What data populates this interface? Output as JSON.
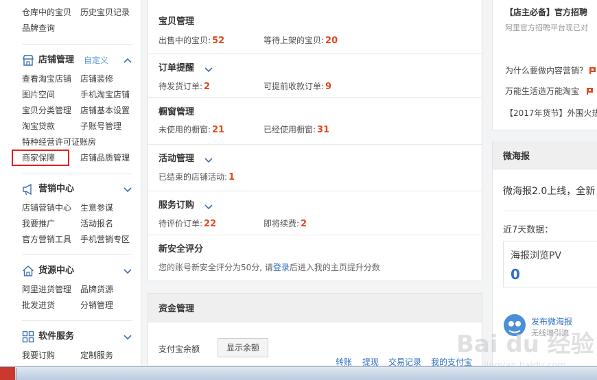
{
  "sidebar": {
    "top_row": {
      "a": "仓库中的宝贝",
      "b": "历史宝贝记录"
    },
    "brand_query": "品牌查询",
    "store": {
      "title": "店铺管理",
      "customize": "自定义",
      "links": [
        [
          "查看淘宝店铺",
          "店铺装修"
        ],
        [
          "图片空间",
          "手机淘宝店铺"
        ],
        [
          "宝贝分类管理",
          "店铺基本设置"
        ],
        [
          "淘宝贷款",
          "子账号管理"
        ],
        [
          "特种经营许可证账房",
          ""
        ],
        [
          "商家保障",
          "店铺品质管理"
        ]
      ]
    },
    "marketing": {
      "title": "营销中心",
      "links": [
        [
          "店铺营销中心",
          "生意参谋"
        ],
        [
          "我要推广",
          "活动报名"
        ],
        [
          "官方营销工具",
          "手机营销专区"
        ]
      ]
    },
    "sourcing": {
      "title": "货源中心",
      "links": [
        [
          "阿里进货管理",
          "品牌货源"
        ],
        [
          "批发进货",
          "分销管理"
        ]
      ]
    },
    "software": {
      "title": "软件服务",
      "links": [
        [
          "我要订购",
          "定制服务"
        ]
      ]
    }
  },
  "main": {
    "items": {
      "title": "宝贝管理",
      "on_sale_label": "出售中的宝贝:",
      "on_sale": "52",
      "pending_label": "等待上架的宝贝:",
      "pending": "20"
    },
    "orders": {
      "title": "订单提醒",
      "to_ship_label": "待发货订单:",
      "to_ship": "2",
      "early_pay_label": "可提前收款订单:",
      "early_pay": "9"
    },
    "window": {
      "title": "橱窗管理",
      "unused_label": "未使用的橱窗:",
      "unused": "21",
      "used_label": "已经使用橱窗:",
      "used": "31"
    },
    "activity": {
      "title": "活动管理",
      "ended_label": "已结束的店铺活动:",
      "ended": "1"
    },
    "service": {
      "title": "服务订购",
      "to_review_label": "待评价订单:",
      "to_review": "22",
      "renew_label": "即将续费:",
      "renew": "2"
    },
    "security": {
      "title": "新安全评分",
      "text_pre": "您的账号新安全评分为50分, 请",
      "login": "登录",
      "text_post": "后进入我的主页提升分数"
    }
  },
  "finance": {
    "title": "资金管理",
    "balance_label": "支付宝余额",
    "show_balance": "显示余额",
    "links": [
      "转账",
      "提现",
      "交易记录",
      "我的支付宝"
    ]
  },
  "right": {
    "headline": "【店主必备】官方招聘",
    "sub": "阿里官方招聘平台现已对",
    "news": [
      "为什么要做内容营销？",
      "万能生活造万能淘宝",
      "【2017年货节】外围火热"
    ],
    "wh": {
      "title": "微海报",
      "announce": "微海报2.0上线，全新",
      "recent": "近7天数据：",
      "pv_label": "海报浏览PV",
      "pv_value": "0",
      "publish": "发布微海报",
      "publish_sub": "无线增引流"
    }
  },
  "watermark": {
    "text": "Bai du 经验",
    "sub": "jingyan.baidu.com"
  },
  "colors": {
    "accent_number": "#e4461c",
    "link": "#2f6fc5",
    "highlight": "#e02020",
    "custom_link": "#5b9bd5"
  }
}
